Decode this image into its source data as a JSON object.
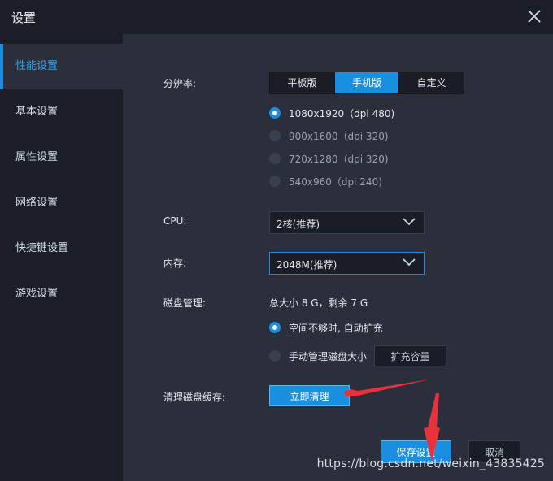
{
  "window": {
    "title": "设置"
  },
  "sidebar": {
    "items": [
      {
        "label": "性能设置",
        "active": true
      },
      {
        "label": "基本设置"
      },
      {
        "label": "属性设置"
      },
      {
        "label": "网络设置"
      },
      {
        "label": "快捷键设置"
      },
      {
        "label": "游戏设置"
      }
    ]
  },
  "performance": {
    "resolution_label": "分辨率:",
    "modes": [
      "平板版",
      "手机版",
      "自定义"
    ],
    "selected_mode": "手机版",
    "resolutions": [
      {
        "label": "1080x1920（dpi 480)",
        "selected": true
      },
      {
        "label": "900x1600（dpi 320)"
      },
      {
        "label": "720x1280（dpi 320)"
      },
      {
        "label": "540x960（dpi 240)"
      }
    ],
    "cpu_label": "CPU:",
    "cpu_value": "2核(推荐)",
    "memory_label": "内存:",
    "memory_value": "2048M(推荐)",
    "disk_label": "磁盘管理:",
    "disk_info": "总大小 8 G，剩余 7 G",
    "disk_auto": "空间不够时, 自动扩充",
    "disk_manual": "手动管理磁盘大小",
    "expand_button": "扩充容量",
    "cache_label": "清理磁盘缓存:",
    "clean_button": "立即清理"
  },
  "footer": {
    "save_button": "保存设置",
    "cancel_button": "取消"
  },
  "watermark": "https://blog.csdn.net/weixin_43835425",
  "colors": {
    "accent": "#1a8fe0",
    "annotation_arrow": "#e8313a"
  }
}
